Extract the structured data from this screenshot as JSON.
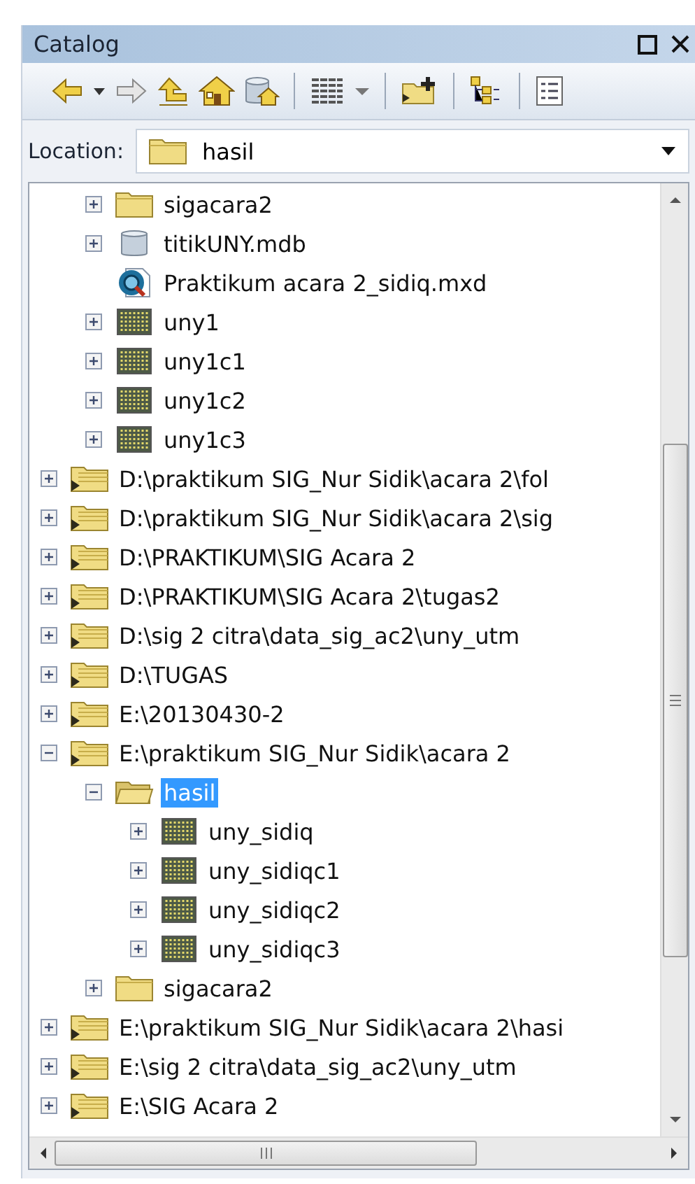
{
  "window": {
    "title": "Catalog"
  },
  "location": {
    "label": "Location:",
    "value": "hasil"
  },
  "tree": {
    "scrolled_children": [
      {
        "name": "sigacara2",
        "kind": "folder",
        "expanded": false
      },
      {
        "name": "titikUNY.mdb",
        "kind": "database",
        "expanded": false
      },
      {
        "name": "Praktikum acara 2_sidiq.mxd",
        "kind": "map"
      },
      {
        "name": "uny1",
        "kind": "raster",
        "expanded": false
      },
      {
        "name": "uny1c1",
        "kind": "raster",
        "expanded": false
      },
      {
        "name": "uny1c2",
        "kind": "raster",
        "expanded": false
      },
      {
        "name": "uny1c3",
        "kind": "raster",
        "expanded": false
      }
    ],
    "items": [
      {
        "name": "D:\\praktikum SIG_Nur Sidik\\acara 2\\fol",
        "kind": "connection",
        "expanded": false,
        "selected": false
      },
      {
        "name": "D:\\praktikum SIG_Nur Sidik\\acara 2\\sig",
        "kind": "connection",
        "expanded": false,
        "selected": false
      },
      {
        "name": "D:\\PRAKTIKUM\\SIG Acara 2",
        "kind": "connection",
        "expanded": false,
        "selected": false
      },
      {
        "name": "D:\\PRAKTIKUM\\SIG Acara 2\\tugas2",
        "kind": "connection",
        "expanded": false,
        "selected": false
      },
      {
        "name": "D:\\sig 2 citra\\data_sig_ac2\\uny_utm",
        "kind": "connection",
        "expanded": false,
        "selected": false
      },
      {
        "name": "D:\\TUGAS",
        "kind": "connection",
        "expanded": false,
        "selected": false
      },
      {
        "name": "E:\\20130430-2",
        "kind": "connection",
        "expanded": false,
        "selected": false
      },
      {
        "name": "E:\\praktikum SIG_Nur Sidik\\acara 2",
        "kind": "connection",
        "expanded": true,
        "selected": false,
        "children": [
          {
            "name": "hasil",
            "kind": "folder",
            "expanded": true,
            "selected": true,
            "children": [
              {
                "name": "uny_sidiq",
                "kind": "raster",
                "expanded": false,
                "selected": false
              },
              {
                "name": "uny_sidiqc1",
                "kind": "raster",
                "expanded": false,
                "selected": false
              },
              {
                "name": "uny_sidiqc2",
                "kind": "raster",
                "expanded": false,
                "selected": false
              },
              {
                "name": "uny_sidiqc3",
                "kind": "raster",
                "expanded": false,
                "selected": false
              }
            ]
          },
          {
            "name": "sigacara2",
            "kind": "folder",
            "expanded": false,
            "selected": false
          }
        ]
      },
      {
        "name": "E:\\praktikum SIG_Nur Sidik\\acara 2\\hasi",
        "kind": "connection",
        "expanded": false,
        "selected": false
      },
      {
        "name": "E:\\sig 2 citra\\data_sig_ac2\\uny_utm",
        "kind": "connection",
        "expanded": false,
        "selected": false
      },
      {
        "name": "E:\\SIG Acara 2",
        "kind": "connection",
        "expanded": false,
        "selected": false
      }
    ]
  }
}
